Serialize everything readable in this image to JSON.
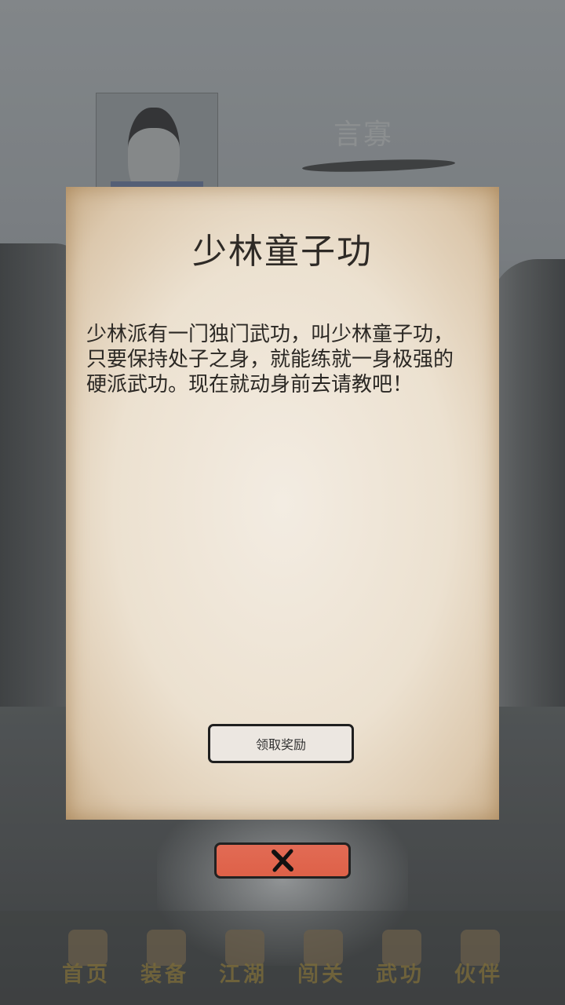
{
  "background": {
    "npc_name": "言寡"
  },
  "dialog": {
    "title": "少林童子功",
    "body": "少林派有一门独门武功，叫少林童子功，只要保持处子之身，就能练就一身极强的硬派武功。现在就动身前去请教吧！",
    "claim_label": "领取奖励",
    "close_icon": "close-icon"
  },
  "nav": {
    "items": [
      {
        "label": "首页",
        "icon": "home-icon"
      },
      {
        "label": "装备",
        "icon": "equipment-icon"
      },
      {
        "label": "江湖",
        "icon": "world-icon"
      },
      {
        "label": "闯关",
        "icon": "stage-icon"
      },
      {
        "label": "武功",
        "icon": "martial-arts-icon"
      },
      {
        "label": "伙伴",
        "icon": "partners-icon"
      }
    ]
  },
  "colors": {
    "close_button": "#de6148",
    "parchment": "#ece1d0"
  }
}
